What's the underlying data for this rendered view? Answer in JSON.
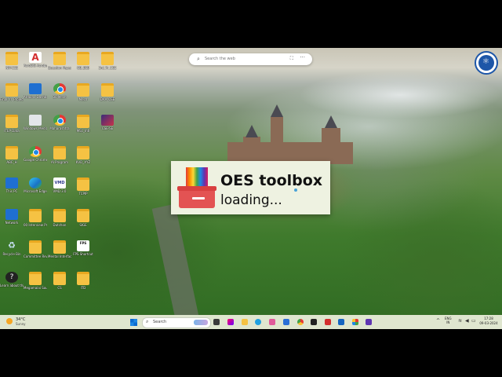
{
  "desktop": {
    "icons": [
      {
        "label": "NIT-CSE",
        "glyph": "folder"
      },
      {
        "label": "AcroDIS Acrobat Reader",
        "glyph": "acrobat"
      },
      {
        "label": "Question Paper",
        "glyph": "folder"
      },
      {
        "label": "GB_BSB",
        "glyph": "folder"
      },
      {
        "label": "3rd_Yr_CSE",
        "glyph": "folder"
      },
      {
        "label": "Final_Yr_Project",
        "glyph": "folder"
      },
      {
        "label": "Arduino Dashboard",
        "glyph": "blue"
      },
      {
        "label": "30 Mech",
        "glyph": "chrome"
      },
      {
        "label": "Mech",
        "glyph": "folder"
      },
      {
        "label": "DAA_CSE",
        "glyph": "folder"
      },
      {
        "label": "ITEP Data",
        "glyph": "folder"
      },
      {
        "label": "Windows Media Player",
        "glyph": "doc"
      },
      {
        "label": "Maharashtra",
        "glyph": "chrome"
      },
      {
        "label": "MSc_Intl",
        "glyph": "folder"
      },
      {
        "label": "CSE-SE",
        "glyph": "img"
      },
      {
        "label": "ABC_H",
        "glyph": "folder"
      },
      {
        "label": "Google Chrome",
        "glyph": "chrome"
      },
      {
        "label": "AI Program",
        "glyph": "folder"
      },
      {
        "label": "KVD_XYZ",
        "glyph": "folder"
      },
      {
        "label": "This PC",
        "glyph": "blue"
      },
      {
        "label": "Microsoft Edge",
        "glyph": "edge"
      },
      {
        "label": "VMD 3.0",
        "glyph": "vmd"
      },
      {
        "label": "TCPIP",
        "glyph": "folder"
      },
      {
        "label": "Network",
        "glyph": "blue"
      },
      {
        "label": "00 Interview Project",
        "glyph": "folder"
      },
      {
        "label": "Dutchon",
        "glyph": "folder"
      },
      {
        "label": "SIGE",
        "glyph": "folder"
      },
      {
        "label": "Recycle Bin",
        "glyph": "recycle"
      },
      {
        "label": "Committee Review",
        "glyph": "folder"
      },
      {
        "label": "Mental Interface",
        "glyph": "folder"
      },
      {
        "label": "FPS Shortcut",
        "glyph": "fps"
      },
      {
        "label": "Learn about this picture",
        "glyph": "learn"
      },
      {
        "label": "Megamalai Southern",
        "glyph": "folder"
      },
      {
        "label": "CS",
        "glyph": "folder"
      },
      {
        "label": "ITD",
        "glyph": "folder"
      }
    ]
  },
  "search": {
    "placeholder": "Search the web",
    "more": "···"
  },
  "splash": {
    "title": "OES toolbox",
    "subtitle": "loading..."
  },
  "taskbar": {
    "weather_temp": "34°C",
    "weather_desc": "Sunny",
    "search_label": "Search",
    "lang_top": "ENG",
    "lang_bottom": "IN",
    "time": "17:28",
    "date": "09-03-2024"
  },
  "colors": {
    "splash_bg": "#eef2e1",
    "taskbar_bg": "#dfe6cf",
    "folder": "#f5c243",
    "logo_blue": "#1d56a8"
  }
}
